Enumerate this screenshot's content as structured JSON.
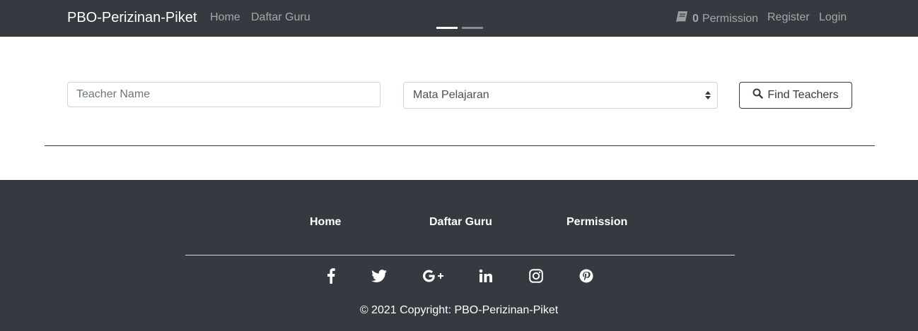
{
  "navbar": {
    "brand": "PBO-Perizinan-Piket",
    "links": {
      "home": "Home",
      "daftar_guru": "Daftar Guru",
      "permission_count": "0",
      "permission": "Permission",
      "register": "Register",
      "login": "Login"
    }
  },
  "search": {
    "teacher_placeholder": "Teacher Name",
    "subject_selected": "Mata Pelajaran",
    "find_button": "Find Teachers"
  },
  "footer": {
    "links": {
      "home": "Home",
      "daftar_guru": "Daftar Guru",
      "permission": "Permission"
    },
    "social_icons": [
      "facebook-icon",
      "twitter-icon",
      "google-plus-icon",
      "linkedin-icon",
      "instagram-icon",
      "pinterest-icon"
    ],
    "copyright": "© 2021 Copyright: PBO-Perizinan-Piket"
  },
  "colors": {
    "dark": "#343a40",
    "muted_nav": "#9a9da0",
    "white": "#ffffff"
  }
}
